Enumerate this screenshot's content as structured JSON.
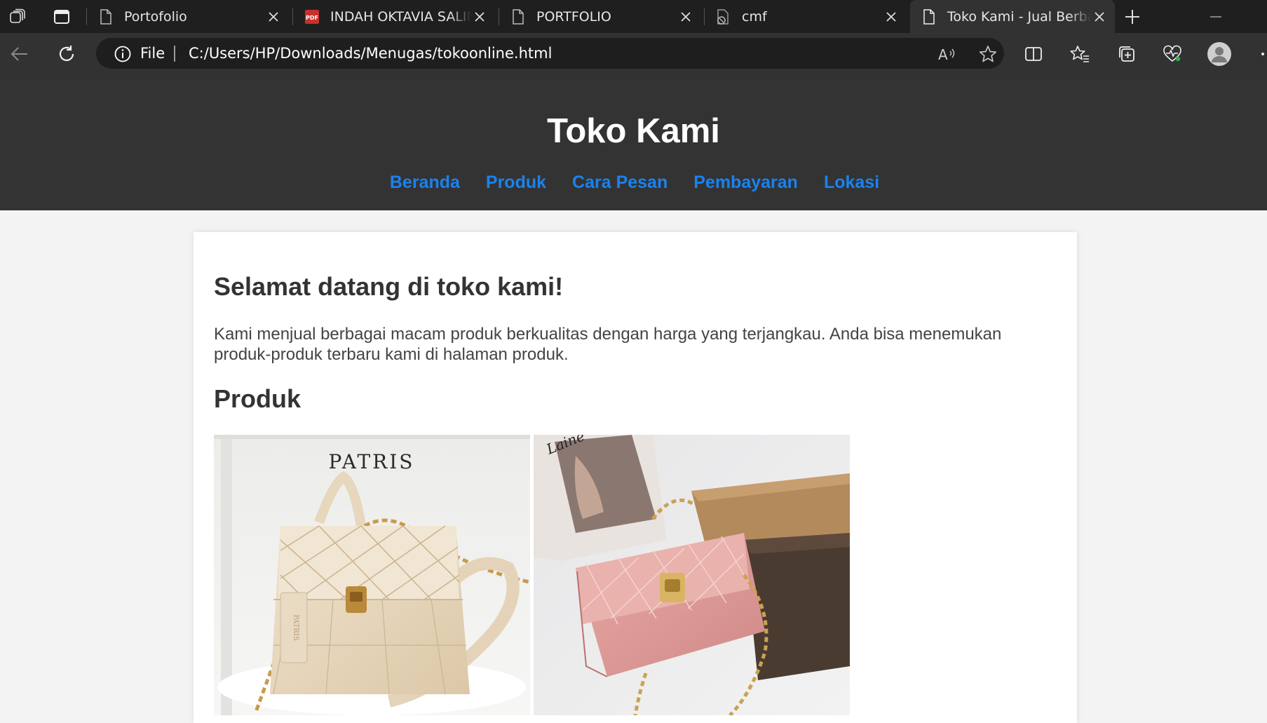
{
  "browser": {
    "tabs": [
      {
        "title": "Portofolio",
        "icon": "page-icon"
      },
      {
        "title": "INDAH OKTAVIA SALIM (",
        "icon": "pdf-icon"
      },
      {
        "title": "PORTFOLIO",
        "icon": "page-icon"
      },
      {
        "title": "cmf",
        "icon": "blocked-file-icon"
      },
      {
        "title": "Toko Kami - Jual Berbagai",
        "icon": "page-icon",
        "active": true
      }
    ],
    "pdf_badge": "PDF",
    "address": {
      "scheme_label": "File",
      "url": "C:/Users/HP/Downloads/Menugas/tokoonline.html"
    },
    "read_aloud_glyph": "A"
  },
  "page": {
    "title": "Toko Kami",
    "nav": [
      "Beranda",
      "Produk",
      "Cara Pesan",
      "Pembayaran",
      "Lokasi"
    ],
    "welcome_heading": "Selamat datang di toko kami!",
    "intro_text": "Kami menjual berbagai macam produk berkualitas dengan harga yang terjangkau. Anda bisa menemukan produk-produk terbaru kami di halaman produk.",
    "products_heading": "Produk",
    "products": [
      {
        "name": "cream-quilted-bag",
        "brand_text": "PATRIS",
        "tag_text": "PATRIS"
      },
      {
        "name": "pink-quilted-bag",
        "magazine_text": "Laine"
      }
    ]
  },
  "colors": {
    "chrome_dark": "#1f1f1f",
    "chrome_toolbar": "#323232",
    "header_bg": "#333333",
    "nav_link": "#1a82f0",
    "body_bg": "#f3f3f3"
  }
}
